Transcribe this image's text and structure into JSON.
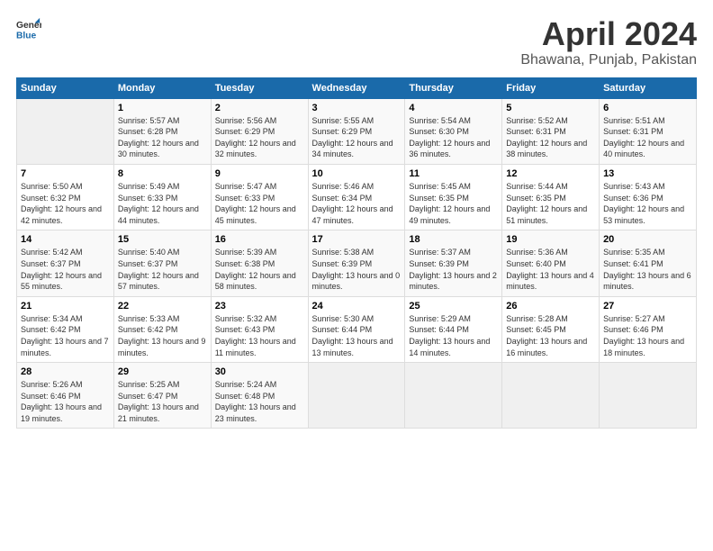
{
  "logo": {
    "line1": "General",
    "line2": "Blue"
  },
  "title": "April 2024",
  "subtitle": "Bhawana, Punjab, Pakistan",
  "days_of_week": [
    "Sunday",
    "Monday",
    "Tuesday",
    "Wednesday",
    "Thursday",
    "Friday",
    "Saturday"
  ],
  "weeks": [
    [
      {
        "day": "",
        "sunrise": "",
        "sunset": "",
        "daylight": ""
      },
      {
        "day": "1",
        "sunrise": "Sunrise: 5:57 AM",
        "sunset": "Sunset: 6:28 PM",
        "daylight": "Daylight: 12 hours and 30 minutes."
      },
      {
        "day": "2",
        "sunrise": "Sunrise: 5:56 AM",
        "sunset": "Sunset: 6:29 PM",
        "daylight": "Daylight: 12 hours and 32 minutes."
      },
      {
        "day": "3",
        "sunrise": "Sunrise: 5:55 AM",
        "sunset": "Sunset: 6:29 PM",
        "daylight": "Daylight: 12 hours and 34 minutes."
      },
      {
        "day": "4",
        "sunrise": "Sunrise: 5:54 AM",
        "sunset": "Sunset: 6:30 PM",
        "daylight": "Daylight: 12 hours and 36 minutes."
      },
      {
        "day": "5",
        "sunrise": "Sunrise: 5:52 AM",
        "sunset": "Sunset: 6:31 PM",
        "daylight": "Daylight: 12 hours and 38 minutes."
      },
      {
        "day": "6",
        "sunrise": "Sunrise: 5:51 AM",
        "sunset": "Sunset: 6:31 PM",
        "daylight": "Daylight: 12 hours and 40 minutes."
      }
    ],
    [
      {
        "day": "7",
        "sunrise": "Sunrise: 5:50 AM",
        "sunset": "Sunset: 6:32 PM",
        "daylight": "Daylight: 12 hours and 42 minutes."
      },
      {
        "day": "8",
        "sunrise": "Sunrise: 5:49 AM",
        "sunset": "Sunset: 6:33 PM",
        "daylight": "Daylight: 12 hours and 44 minutes."
      },
      {
        "day": "9",
        "sunrise": "Sunrise: 5:47 AM",
        "sunset": "Sunset: 6:33 PM",
        "daylight": "Daylight: 12 hours and 45 minutes."
      },
      {
        "day": "10",
        "sunrise": "Sunrise: 5:46 AM",
        "sunset": "Sunset: 6:34 PM",
        "daylight": "Daylight: 12 hours and 47 minutes."
      },
      {
        "day": "11",
        "sunrise": "Sunrise: 5:45 AM",
        "sunset": "Sunset: 6:35 PM",
        "daylight": "Daylight: 12 hours and 49 minutes."
      },
      {
        "day": "12",
        "sunrise": "Sunrise: 5:44 AM",
        "sunset": "Sunset: 6:35 PM",
        "daylight": "Daylight: 12 hours and 51 minutes."
      },
      {
        "day": "13",
        "sunrise": "Sunrise: 5:43 AM",
        "sunset": "Sunset: 6:36 PM",
        "daylight": "Daylight: 12 hours and 53 minutes."
      }
    ],
    [
      {
        "day": "14",
        "sunrise": "Sunrise: 5:42 AM",
        "sunset": "Sunset: 6:37 PM",
        "daylight": "Daylight: 12 hours and 55 minutes."
      },
      {
        "day": "15",
        "sunrise": "Sunrise: 5:40 AM",
        "sunset": "Sunset: 6:37 PM",
        "daylight": "Daylight: 12 hours and 57 minutes."
      },
      {
        "day": "16",
        "sunrise": "Sunrise: 5:39 AM",
        "sunset": "Sunset: 6:38 PM",
        "daylight": "Daylight: 12 hours and 58 minutes."
      },
      {
        "day": "17",
        "sunrise": "Sunrise: 5:38 AM",
        "sunset": "Sunset: 6:39 PM",
        "daylight": "Daylight: 13 hours and 0 minutes."
      },
      {
        "day": "18",
        "sunrise": "Sunrise: 5:37 AM",
        "sunset": "Sunset: 6:39 PM",
        "daylight": "Daylight: 13 hours and 2 minutes."
      },
      {
        "day": "19",
        "sunrise": "Sunrise: 5:36 AM",
        "sunset": "Sunset: 6:40 PM",
        "daylight": "Daylight: 13 hours and 4 minutes."
      },
      {
        "day": "20",
        "sunrise": "Sunrise: 5:35 AM",
        "sunset": "Sunset: 6:41 PM",
        "daylight": "Daylight: 13 hours and 6 minutes."
      }
    ],
    [
      {
        "day": "21",
        "sunrise": "Sunrise: 5:34 AM",
        "sunset": "Sunset: 6:42 PM",
        "daylight": "Daylight: 13 hours and 7 minutes."
      },
      {
        "day": "22",
        "sunrise": "Sunrise: 5:33 AM",
        "sunset": "Sunset: 6:42 PM",
        "daylight": "Daylight: 13 hours and 9 minutes."
      },
      {
        "day": "23",
        "sunrise": "Sunrise: 5:32 AM",
        "sunset": "Sunset: 6:43 PM",
        "daylight": "Daylight: 13 hours and 11 minutes."
      },
      {
        "day": "24",
        "sunrise": "Sunrise: 5:30 AM",
        "sunset": "Sunset: 6:44 PM",
        "daylight": "Daylight: 13 hours and 13 minutes."
      },
      {
        "day": "25",
        "sunrise": "Sunrise: 5:29 AM",
        "sunset": "Sunset: 6:44 PM",
        "daylight": "Daylight: 13 hours and 14 minutes."
      },
      {
        "day": "26",
        "sunrise": "Sunrise: 5:28 AM",
        "sunset": "Sunset: 6:45 PM",
        "daylight": "Daylight: 13 hours and 16 minutes."
      },
      {
        "day": "27",
        "sunrise": "Sunrise: 5:27 AM",
        "sunset": "Sunset: 6:46 PM",
        "daylight": "Daylight: 13 hours and 18 minutes."
      }
    ],
    [
      {
        "day": "28",
        "sunrise": "Sunrise: 5:26 AM",
        "sunset": "Sunset: 6:46 PM",
        "daylight": "Daylight: 13 hours and 19 minutes."
      },
      {
        "day": "29",
        "sunrise": "Sunrise: 5:25 AM",
        "sunset": "Sunset: 6:47 PM",
        "daylight": "Daylight: 13 hours and 21 minutes."
      },
      {
        "day": "30",
        "sunrise": "Sunrise: 5:24 AM",
        "sunset": "Sunset: 6:48 PM",
        "daylight": "Daylight: 13 hours and 23 minutes."
      },
      {
        "day": "",
        "sunrise": "",
        "sunset": "",
        "daylight": ""
      },
      {
        "day": "",
        "sunrise": "",
        "sunset": "",
        "daylight": ""
      },
      {
        "day": "",
        "sunrise": "",
        "sunset": "",
        "daylight": ""
      },
      {
        "day": "",
        "sunrise": "",
        "sunset": "",
        "daylight": ""
      }
    ]
  ]
}
